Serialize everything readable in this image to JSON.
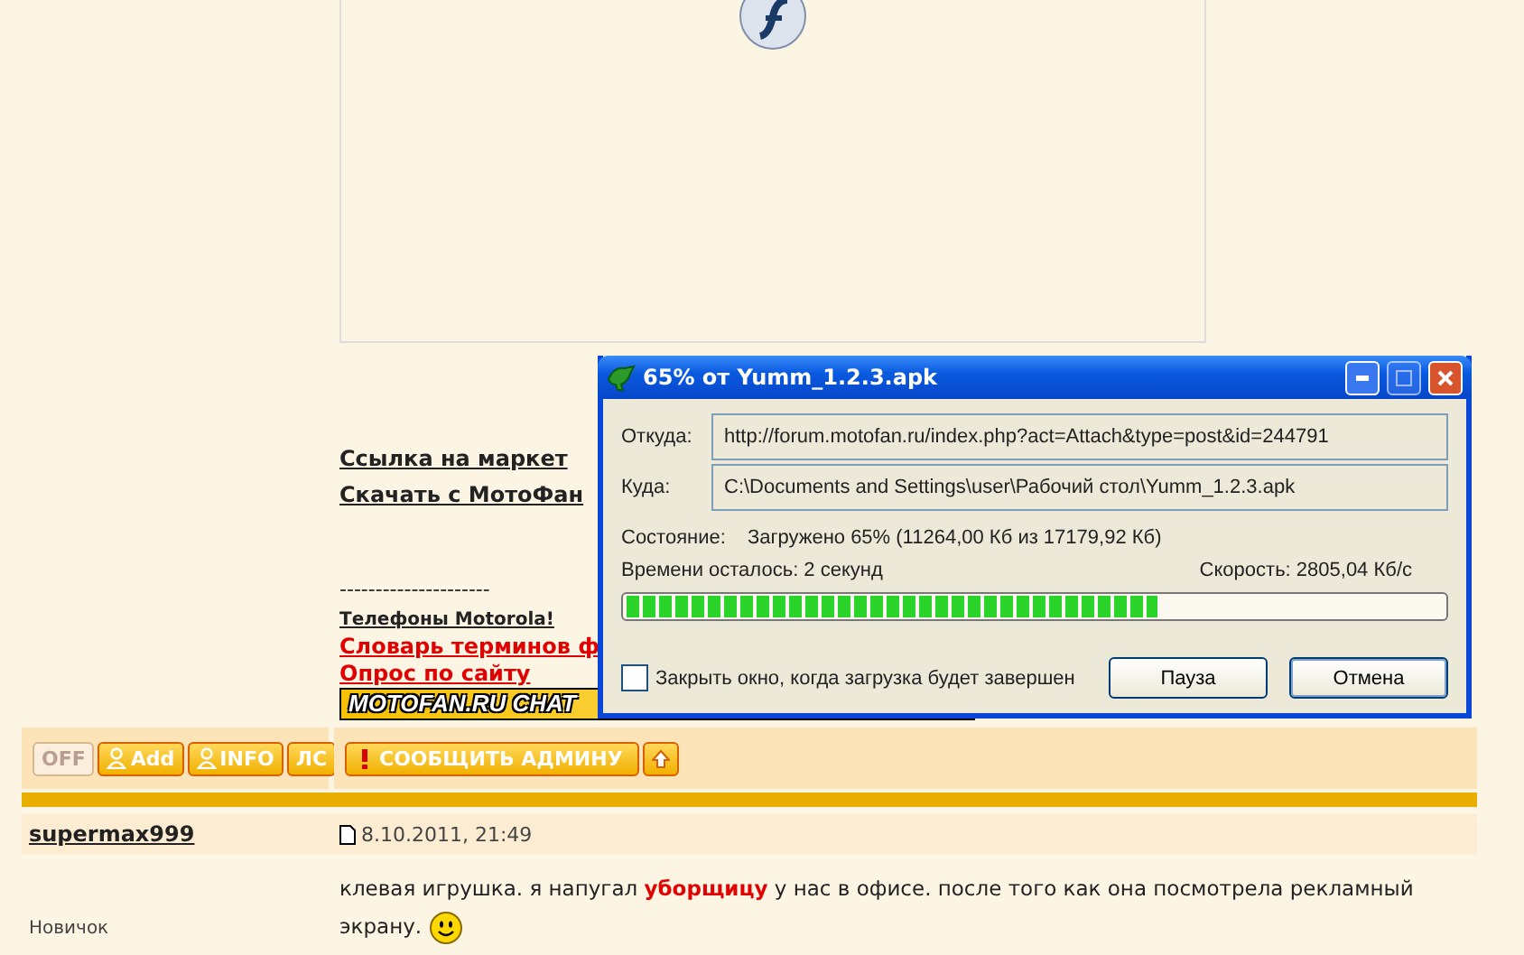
{
  "post_top": {
    "links": [
      {
        "text": "Ссылка на маркет"
      },
      {
        "text": "Скачать с МотоФан"
      }
    ],
    "separator": "---------------------",
    "footer_links": [
      {
        "text": "Телефоны Motorola!",
        "kind": "dark"
      },
      {
        "text": "Словарь терминов ф",
        "kind": "red"
      },
      {
        "text": "Опрос по сайту",
        "kind": "red"
      }
    ],
    "banner": "MOTOFAN.RU CHAT"
  },
  "post_toolbar": {
    "user_buttons": [
      {
        "label": "OFF",
        "kind": "status"
      },
      {
        "label": "Add",
        "kind": "add"
      },
      {
        "label": "INFO",
        "kind": "info"
      },
      {
        "label": "ЛС",
        "kind": "plain"
      }
    ],
    "report_button": "СООБЩИТЬ АДМИНУ"
  },
  "post": {
    "author": "supermax999",
    "rank": "Новичок",
    "date": "8.10.2011, 21:49",
    "lines": [
      "клевая игрушка. я напугал **уборщицу** у нас в офисе. после того как она посмотрела рекламный",
      "экрану."
    ]
  },
  "download_dialog": {
    "title": "65% от Yumm_1.2.3.apk",
    "from_label": "Откуда:",
    "from": "http://forum.motofan.ru/index.php?act=Attach&type=post&id=244791",
    "to_label": "Куда:",
    "to": "C:\\Documents and Settings\\user\\Рабочий стол\\Yumm_1.2.3.apk",
    "status_label": "Состояние:",
    "status": "Загружено 65% (11264,00 Кб из 17179,92 Кб)",
    "time_left": "Времени осталось: 2 секунд",
    "speed": "Скорость: 2805,04 Кб/с",
    "level": 0.65,
    "close_when_done": {
      "label": "Закрыть окно, когда загрузка будет завершен",
      "checked": false
    },
    "buttons": [
      {
        "label": "Пауза",
        "default": false
      },
      {
        "label": "Отмена",
        "default": true
      }
    ]
  }
}
